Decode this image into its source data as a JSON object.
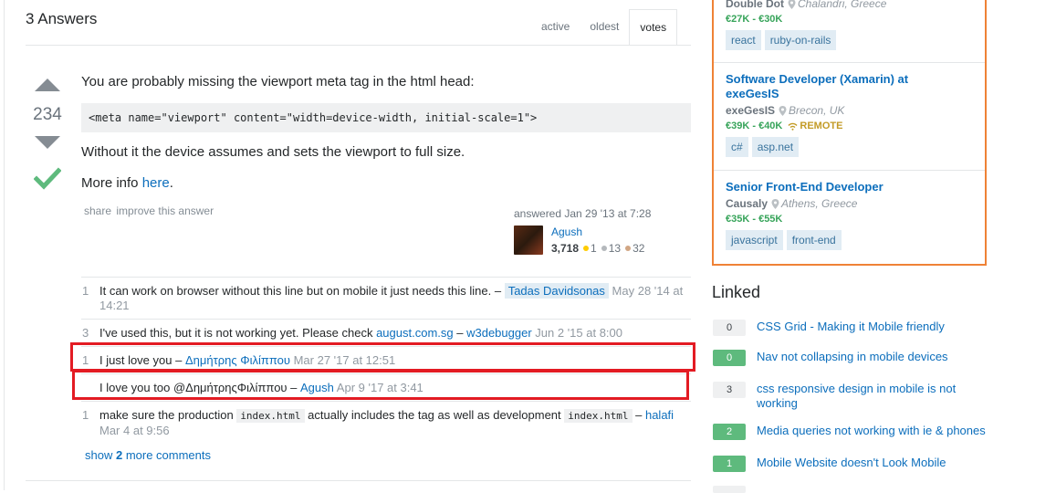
{
  "answers": {
    "title": "3 Answers",
    "tabs": [
      "active",
      "oldest",
      "votes"
    ]
  },
  "answer": {
    "votes": "234",
    "accepted": true,
    "body_intro": "You are probably missing the viewport meta tag in the html head:",
    "code": "<meta name=\"viewport\" content=\"width=device-width, initial-scale=1\">",
    "body_middle": "Without it the device assumes and sets the viewport to full size.",
    "more_info_prefix": "More info ",
    "more_info_link": "here",
    "more_info_suffix": ".",
    "menu": {
      "share": "share",
      "improve": "improve this answer"
    },
    "signature": {
      "action": "answered Jan 29 '13 at 7:28",
      "user": "Agush",
      "reputation": "3,718",
      "gold": "1",
      "silver": "13",
      "bronze": "32"
    }
  },
  "comments": [
    {
      "score": "1",
      "text": "It can work on browser without this line but on mobile it just needs this line. –",
      "user": "Tadas Davidsonas",
      "date": "May 28 '14 at 14:21"
    },
    {
      "score": "3",
      "text_before": "I've used this, but it is not working yet. Please check ",
      "link": "august.com.sg",
      "text_after": " –",
      "user": "w3debugger",
      "date": "Jun 2 '15 at 8:00"
    },
    {
      "score": "1",
      "text": "I just love you –",
      "user": "Δημήτρης Φιλίππου",
      "date": "Mar 27 '17 at 12:51"
    },
    {
      "score": "",
      "text": "I love you too @ΔημήτρηςΦιλίππου –",
      "user": "Agush",
      "date": "Apr 9 '17 at 3:41"
    },
    {
      "score": "1",
      "text_a": "make sure the production ",
      "code_a": "index.html",
      "text_b": " actually includes the tag as well as development ",
      "code_b": "index.html",
      "text_c": " –",
      "user": "halafi",
      "date": "Mar 4 at 9:56"
    }
  ],
  "show_more": {
    "prefix": "show ",
    "count": "2",
    "suffix": " more comments"
  },
  "jobs": [
    {
      "company": "Double Dot",
      "location": "Chalandri, Greece",
      "salary": "€27K - €30K",
      "tags": [
        "react",
        "ruby-on-rails"
      ]
    },
    {
      "title_line1": "Software Developer (Xamarin) at",
      "title_line2": "exeGesIS",
      "company": "exeGesIS",
      "location": "Brecon, UK",
      "salary": "€39K - €40K",
      "remote": "REMOTE",
      "tags": [
        "c#",
        "asp.net"
      ]
    },
    {
      "title_line1": "Senior Front-End Developer",
      "company": "Causaly",
      "location": "Athens, Greece",
      "salary": "€35K - €55K",
      "tags": [
        "javascript",
        "front-end"
      ]
    }
  ],
  "linked": {
    "title": "Linked",
    "items": [
      {
        "count": "0",
        "text": "CSS Grid - Making it Mobile friendly"
      },
      {
        "count": "0",
        "text": "Nav not collapsing in mobile devices"
      },
      {
        "count": "3",
        "text": "css responsive design in mobile is not working"
      },
      {
        "count": "2",
        "text": "Media queries not working with ie & phones"
      },
      {
        "count": "1",
        "text": "Mobile Website doesn't Look Mobile"
      }
    ]
  },
  "colors": {
    "accent_link": "#0c6ebc",
    "highlight_box": "#e31b23",
    "jobs_border": "#ef8236",
    "accepted_check": "#5eba7d"
  }
}
